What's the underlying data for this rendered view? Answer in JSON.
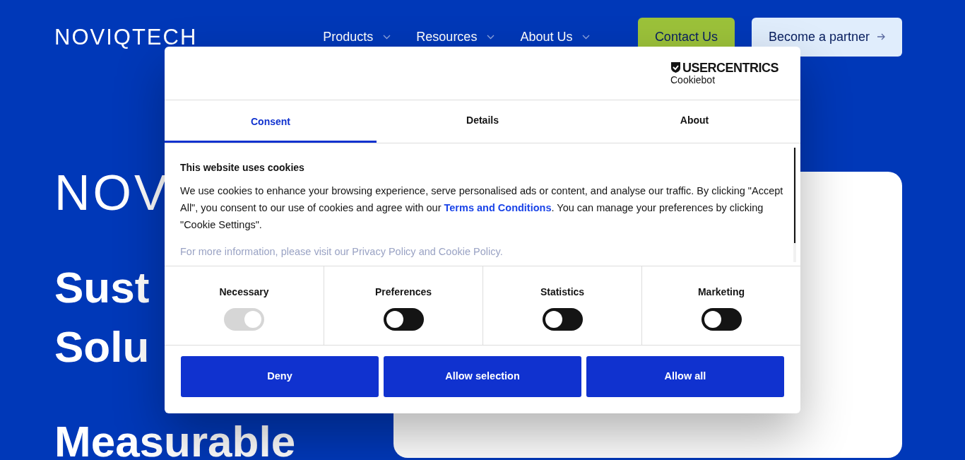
{
  "header": {
    "logo": "NOVIQTECH",
    "nav": [
      {
        "label": "Products"
      },
      {
        "label": "Resources"
      },
      {
        "label": "About Us"
      }
    ],
    "contact_button": "Contact Us",
    "partner_button": "Become a partner"
  },
  "hero": {
    "logo_text": "NOV",
    "headline_lines": [
      "Sust",
      "Solu",
      "Measurable"
    ]
  },
  "cookie_dialog": {
    "brand": "USERCENTRICS",
    "brand_sub": "Cookiebot",
    "tabs": [
      {
        "label": "Consent",
        "selected": true
      },
      {
        "label": "Details",
        "selected": false
      },
      {
        "label": "About",
        "selected": false
      }
    ],
    "heading": "This website uses cookies",
    "body": "We use cookies to enhance your browsing experience, serve personalised ads or content, and analyse our traffic. By clicking \"Accept All\", you consent to our use of cookies and agree with our ",
    "link": "Terms and Conditions",
    "body_end": ". You can manage your preferences by clicking \"Cookie Settings\".",
    "more_info": "For more information, please visit our Privacy Policy and Cookie Policy.",
    "toggles": [
      {
        "label": "Necessary",
        "on": true,
        "disabled": true
      },
      {
        "label": "Preferences",
        "on": false,
        "disabled": false
      },
      {
        "label": "Statistics",
        "on": false,
        "disabled": false
      },
      {
        "label": "Marketing",
        "on": false,
        "disabled": false
      }
    ],
    "buttons": [
      "Deny",
      "Allow selection",
      "Allow all"
    ]
  }
}
